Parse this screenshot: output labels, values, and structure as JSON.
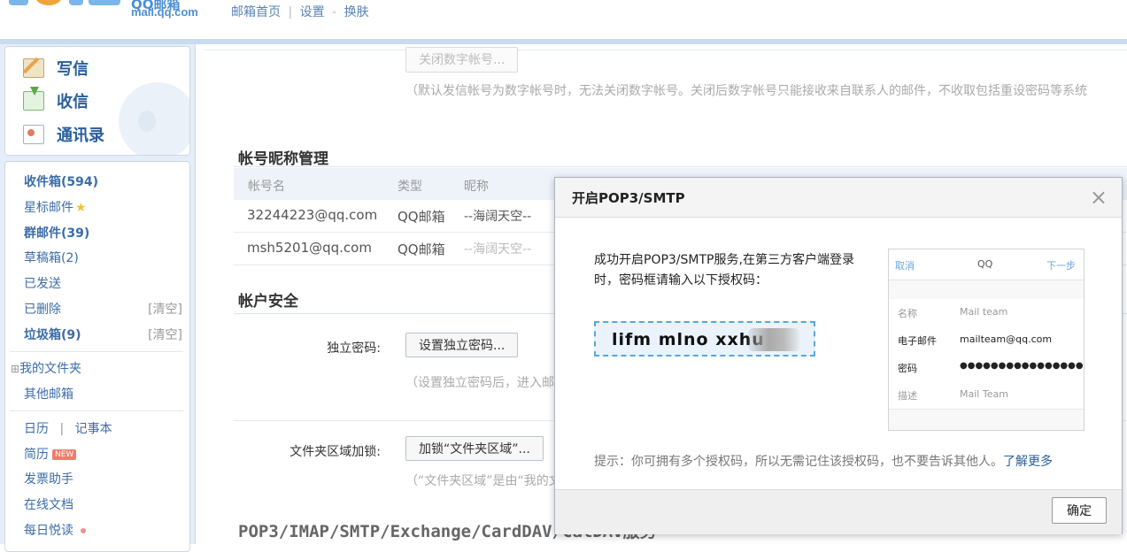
{
  "header": {
    "logo_text": "QQ邮箱",
    "logo_url": "mail.qq.com",
    "nav_home": "邮箱首页",
    "nav_settings": "设置",
    "nav_skin": "换肤",
    "sep1": "|",
    "sep2": "-"
  },
  "actions": {
    "compose": "写信",
    "receive": "收信",
    "contacts": "通讯录"
  },
  "folders": {
    "inbox": "收件箱",
    "inbox_count": "(594)",
    "starred": "星标邮件",
    "group": "群邮件",
    "group_count": "(39)",
    "drafts": "草稿箱",
    "drafts_count": "(2)",
    "sent": "已发送",
    "deleted": "已删除",
    "spam": "垃圾箱",
    "spam_count": "(9)",
    "clear": "[清空]",
    "my_folders": "我的文件夹",
    "other_mailbox": "其他邮箱",
    "calendar": "日历",
    "sep": "|",
    "notes": "记事本",
    "resume": "简历",
    "new_badge": "NEW",
    "invoice": "发票助手",
    "docs": "在线文档",
    "daily_read": "每日悦读"
  },
  "main": {
    "close_digital_button": "关闭数字帐号...",
    "digital_note": "（默认发信帐号为数字帐号时，无法关闭数字帐号。关闭后数字帐号只能接收来自联系人的邮件，不收取包括重设密码等系统",
    "nickname_title": "帐号昵称管理",
    "col_account": "帐号名",
    "col_type": "类型",
    "col_nick": "昵称",
    "rows": [
      {
        "account": "32244223@qq.com",
        "type": "QQ邮箱",
        "nick": "--海阔天空--"
      },
      {
        "account": "msh5201@qq.com",
        "type": "QQ邮箱",
        "nick": "--海阔天空--"
      }
    ],
    "security_title": "帐户安全",
    "indep_pwd_label": "独立密码:",
    "indep_pwd_button": "设置独立密码...",
    "indep_pwd_note": "（设置独立密码后，进入邮",
    "folder_lock_label": "文件夹区域加锁:",
    "folder_lock_button": "加锁“文件夹区域”...",
    "folder_lock_note": "（“文件夹区域”是由“我的文",
    "bottom_title": "POP3/IMAP/SMTP/Exchange/CardDAV/CalDAV服务"
  },
  "dialog": {
    "title": "开启POP3/SMTP",
    "close": "×",
    "message": "成功开启POP3/SMTP服务,在第三方客户端登录时，密码框请输入以下授权码：",
    "code": "lifm mlno xxhu",
    "phone": {
      "cancel": "取消",
      "title": "QQ",
      "next": "下一步",
      "name_key": "名称",
      "name_val": "Mail team",
      "email_key": "电子邮件",
      "email_val": "mailteam@qq.com",
      "pwd_key": "密码",
      "pwd_val": "●●●●●●●●●●●●●●●●",
      "desc_key": "描述",
      "desc_val": "Mail Team"
    },
    "tip": "提示：你可拥有多个授权码，所以无需记住该授权码，也不要告诉其他人。",
    "learn_more": "了解更多",
    "ok": "确定"
  },
  "colors": {
    "brand": "#4b8fd6",
    "link": "#3b6ca8",
    "dialog_border": "#58a7dc"
  }
}
